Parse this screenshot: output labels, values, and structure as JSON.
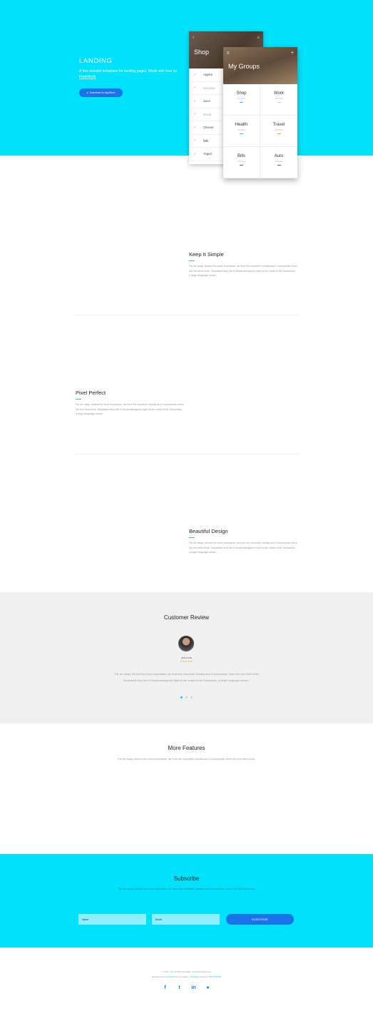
{
  "hero": {
    "title": "LANDING",
    "subtitle": "A free website templates for landing pages. Made with love by",
    "subtitle_link": "FreeHtml5",
    "store_icon": "apple-icon",
    "store_button": "Download on AppStore"
  },
  "shop_phone": {
    "title": "Shop",
    "items": [
      {
        "label": "Apples",
        "done": false
      },
      {
        "label": "Bananas",
        "done": true
      },
      {
        "label": "Juice",
        "done": false
      },
      {
        "label": "Bread",
        "done": true
      },
      {
        "label": "Cheese",
        "done": false
      },
      {
        "label": "Milk",
        "done": false
      },
      {
        "label": "Yogurt",
        "done": false
      }
    ]
  },
  "groups_phone": {
    "title": "My Groups",
    "groups": [
      {
        "name": "Shop",
        "meta": "10 Todos",
        "color": "#1ec8e6"
      },
      {
        "name": "Work",
        "meta": "10 Todos",
        "color": "#cccccc"
      },
      {
        "name": "Health",
        "meta": "10 Todos",
        "color": "#1ec8e6"
      },
      {
        "name": "Travel",
        "meta": "10 Todos",
        "color": "#f5a623"
      },
      {
        "name": "Bills",
        "meta": "10 Todos",
        "color": "#555555"
      },
      {
        "name": "Auto",
        "meta": "10 Todos",
        "color": "#555555"
      }
    ]
  },
  "features": [
    {
      "title": "Keep It Simple",
      "text": "Far far away, behind the word mountains, far from the countries Vokalia and Consonantia, there live the blind texts. Separated they live in Bookmarksgrove right at the coast of the Semantics, a large language ocean."
    },
    {
      "title": "Pixel Perfect",
      "text": "Far far away, behind the word mountains, far from the countries Vokalia and Consonantia, there live the blind texts. Separated they live in Bookmarksgrove right at the coast of the Semantics, a large language ocean."
    },
    {
      "title": "Beautiful Design",
      "text": "Far far away, behind the word mountains, far from the countries Vokalia and Consonantia, there live the blind texts. Separated they live in Bookmarksgrove right at the coast of the Semantics, a large language ocean."
    }
  ],
  "review": {
    "heading": "Customer Review",
    "name": "JEAN DOE",
    "stars": "★★★★★",
    "text": "\"Far far away, behind the word mountains, far from the countries Vokalia and Consonantia, there live the blind texts. Separated they live in Bookmarksgrove right at the coast of the Semantics, a large language ocean.\"",
    "active_dot": 0
  },
  "more_features": {
    "heading": "More Features",
    "text": "Far far away, behind the word mountains, far from the countries Vokalia and Consonantia, there live the blind texts."
  },
  "subscribe": {
    "heading": "Subscribe",
    "text": "Far far away, behind the word mountains, far from the countries Vokalia and Consonantia, there live the blind texts.",
    "name_placeholder": "Name",
    "email_placeholder": "Email",
    "button": "SUBSCRIBE"
  },
  "footer": {
    "copyright": "© 2016. Free HTML5 Template. All Rights Reserved.",
    "designed_by": "Designed by",
    "designer": "FreeHtml5",
    "demo_images_label": "Demo Images:",
    "demo_images_source": "Unsplash",
    "coded_by": "Coded by",
    "coder": "BOOTSNIPP",
    "social": [
      {
        "icon": "facebook-icon",
        "glyph": "f"
      },
      {
        "icon": "twitter-icon",
        "glyph": "t"
      },
      {
        "icon": "linkedin-icon",
        "glyph": "in"
      },
      {
        "icon": "apple-icon",
        "glyph": "●"
      }
    ]
  }
}
